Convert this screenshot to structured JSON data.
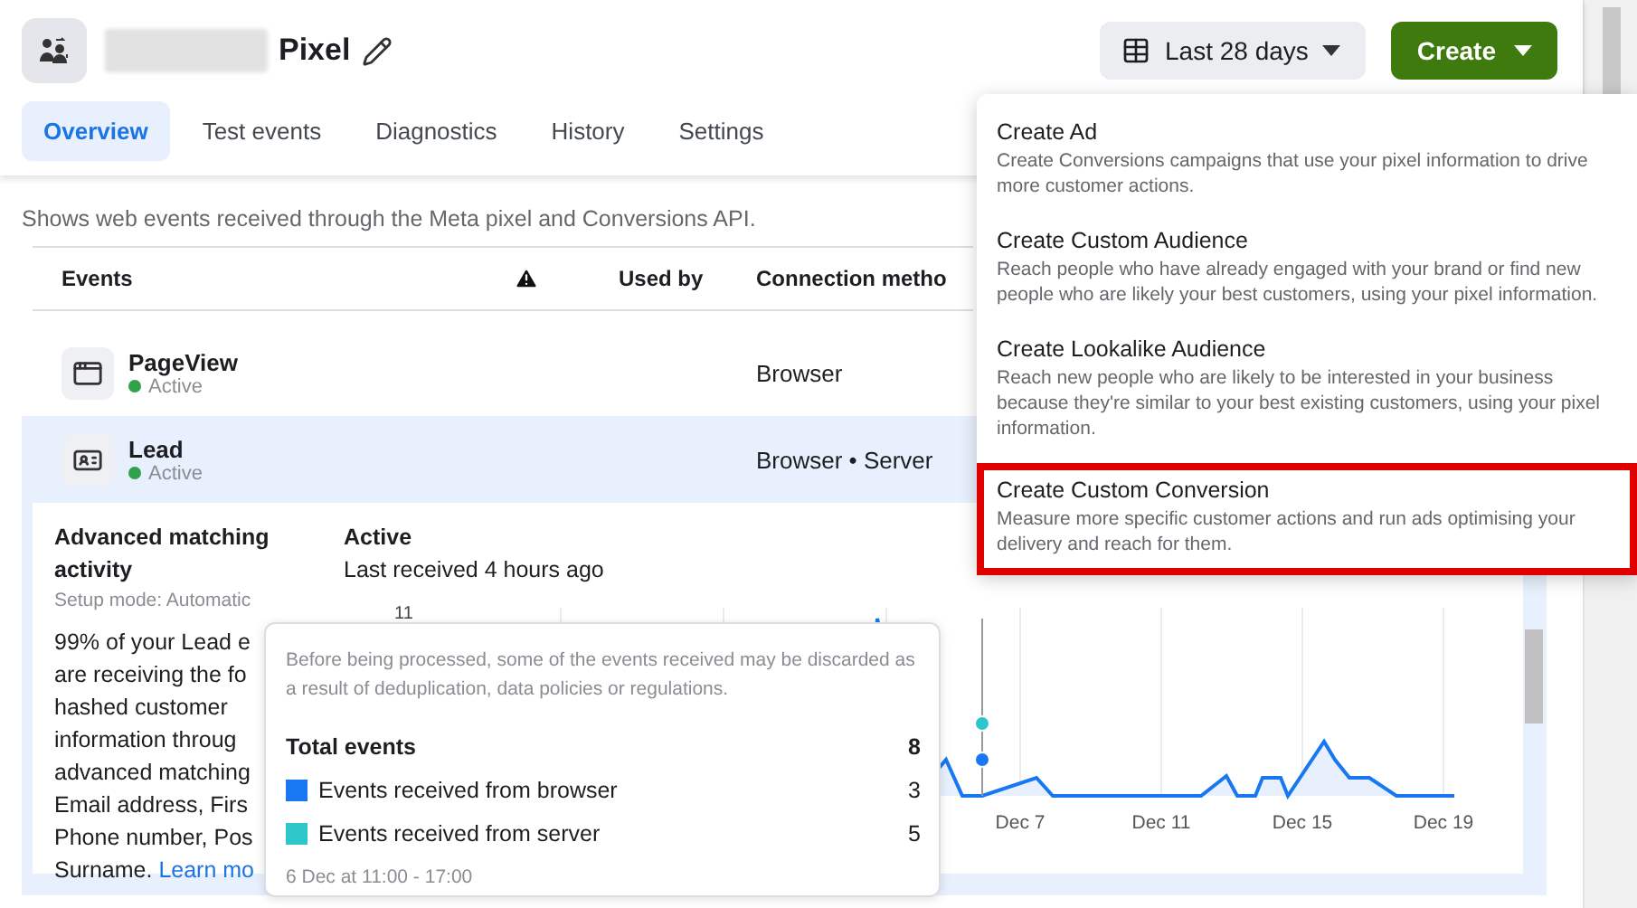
{
  "header": {
    "title": "Pixel",
    "date_range": "Last 28 days",
    "create_button": "Create"
  },
  "tabs": [
    {
      "label": "Overview",
      "selected": true
    },
    {
      "label": "Test events",
      "selected": false
    },
    {
      "label": "Diagnostics",
      "selected": false
    },
    {
      "label": "History",
      "selected": false
    },
    {
      "label": "Settings",
      "selected": false
    }
  ],
  "description": "Shows web events received through the Meta pixel and Conversions API.",
  "table": {
    "columns": [
      "Events",
      "Used by",
      "Connection metho"
    ],
    "rows": [
      {
        "kind": "page",
        "name": "PageView",
        "status": "Active",
        "connection": "Browser",
        "selected": false,
        "expanded": false
      },
      {
        "kind": "lead",
        "name": "Lead",
        "status": "Active",
        "connection": "Browser • Server",
        "selected": true,
        "expanded": true
      }
    ]
  },
  "detail": {
    "matching_title": "Advanced matching activity",
    "setup_mode": "Setup mode: Automatic",
    "paragraph_lines": [
      "99% of your Lead e",
      "are receiving the fo",
      "hashed customer",
      "information throug",
      "advanced matching",
      "Email address, Firs",
      "Phone number, Pos",
      "Surname."
    ],
    "link": "Learn mo",
    "status": "Active",
    "last_received": "Last received 4 hours ago",
    "chart": {
      "y_tick": "11",
      "x_labels": [
        "Dec 7",
        "Dec 11",
        "Dec 15",
        "Dec 19"
      ]
    }
  },
  "tooltip": {
    "note": "Before being processed, some of the events received may be discarded as a result of deduplication, data policies or regulations.",
    "total_label": "Total events",
    "total_value": "8",
    "series": [
      {
        "label": "Events received from browser",
        "value": "3",
        "color": "#1877f2"
      },
      {
        "label": "Events received from server",
        "value": "5",
        "color": "#2ec7c9"
      }
    ],
    "time": "6 Dec at 11:00 - 17:00"
  },
  "create_menu": [
    {
      "title": "Create Ad",
      "description": "Create Conversions campaigns that use your pixel information to drive more customer actions.",
      "highlighted": false
    },
    {
      "title": "Create Custom Audience",
      "description": "Reach people who have already engaged with your brand or find new people who are likely your best customers, using your pixel information.",
      "highlighted": false
    },
    {
      "title": "Create Lookalike Audience",
      "description": "Reach new people who are likely to be interested in your business because they're similar to your best existing customers, using your pixel information.",
      "highlighted": false
    },
    {
      "title": "Create Custom Conversion",
      "description": "Measure more specific customer actions and run ads optimising your delivery and reach for them.",
      "highlighted": true
    }
  ]
}
